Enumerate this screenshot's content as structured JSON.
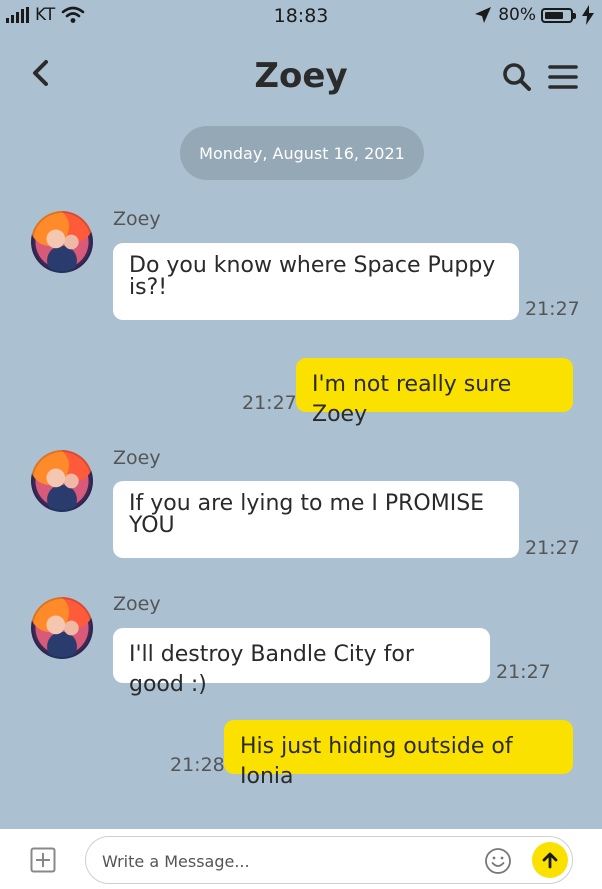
{
  "status_bar": {
    "carrier": "KT",
    "time": "18:83",
    "battery_percent": "80%",
    "battery_level": 0.8
  },
  "header": {
    "title": "Zoey",
    "icons": [
      "back-chevron-icon",
      "search-icon",
      "menu-icon"
    ]
  },
  "date_divider": "Monday, August 16, 2021",
  "messages": [
    {
      "from": "Zoey",
      "sender": "Zoey",
      "lines": [
        "Do you know where Space Puppy",
        "is?!"
      ],
      "time": "21:27",
      "incoming": true
    },
    {
      "from": "me",
      "lines": [
        "I'm not really sure Zoey"
      ],
      "time": "21:27",
      "incoming": false
    },
    {
      "from": "Zoey",
      "sender": "Zoey",
      "lines": [
        "If you are lying to me I PROMISE",
        "YOU"
      ],
      "time": "21:27",
      "incoming": true
    },
    {
      "from": "Zoey",
      "sender": "Zoey",
      "lines": [
        "I'll destroy Bandle City for good :)"
      ],
      "time": "21:27",
      "incoming": true
    },
    {
      "from": "me",
      "lines": [
        "His just hiding outside of Ionia"
      ],
      "time": "21:28",
      "incoming": false
    }
  ],
  "composer": {
    "placeholder": "Write a Message...",
    "value": ""
  },
  "colors": {
    "background": "#abc1d1",
    "my_bubble": "#fae100",
    "their_bubble": "#ffffff",
    "date_pill": "#95a8b6",
    "send_button": "#fae100"
  }
}
